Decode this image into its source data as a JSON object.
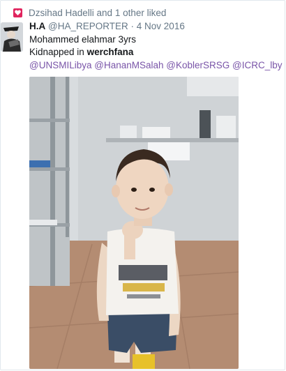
{
  "social_context": {
    "text": "Dzsihad Hadelli and 1 other liked",
    "icon": "heart-icon",
    "icon_color": "#e0245e"
  },
  "tweet": {
    "display_name": "H.A",
    "handle": "@HA_REPORTER",
    "separator": "·",
    "date": "4 Nov 2016",
    "line1": "Mohammed elahmar 3yrs",
    "line2_prefix": "Kidnapped in ",
    "line2_bold": "werchfana",
    "mentions": [
      "@UNSMILibya",
      "@HananMSalah",
      "@KoblerSRSG",
      "@ICRC_lby"
    ]
  },
  "colors": {
    "link": "#7954a8",
    "secondary_text": "#657786",
    "border": "#e1e8ed"
  }
}
